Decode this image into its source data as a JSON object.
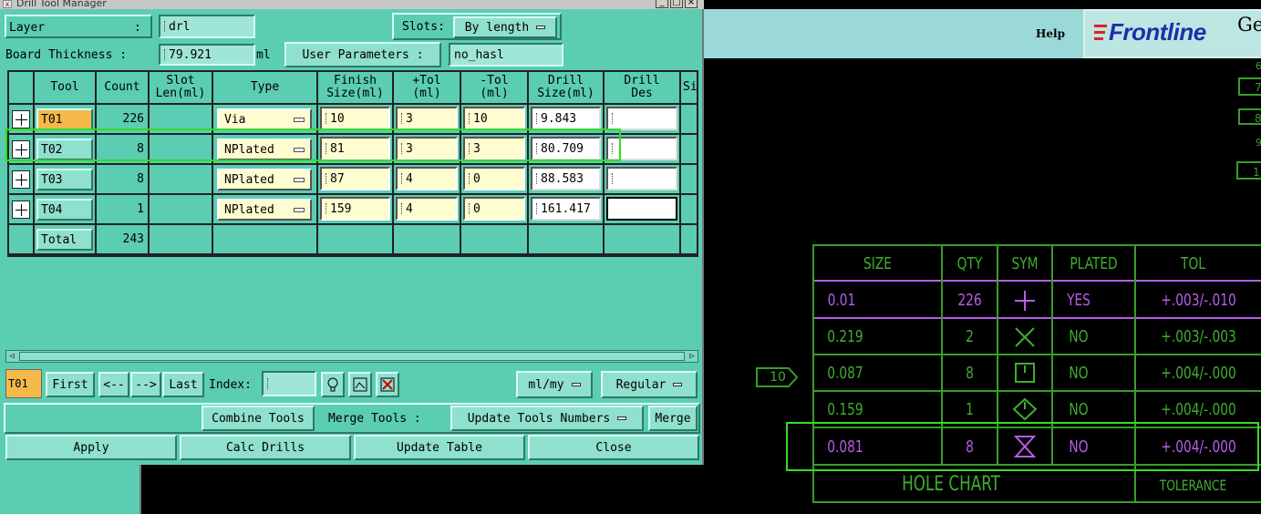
{
  "window": {
    "title": "Drill Tool Manager"
  },
  "top": {
    "layer_label": "Layer",
    "layer_colon": ":",
    "layer_value": "drl",
    "slots_label": "Slots:",
    "slots_value": "By length",
    "thickness_label": "Board Thickness :",
    "thickness_value": "79.921",
    "thickness_unit": "ml",
    "user_params_label": "User Parameters :",
    "user_params_value": "no_hasl"
  },
  "table": {
    "headers": [
      "Tool",
      "Count",
      "Slot\nLen(ml)",
      "Type",
      "Finish\nSize(ml)",
      "+Tol\n(ml)",
      "-Tol\n(ml)",
      "Drill\nSize(ml)",
      "Drill\nDes",
      "Si"
    ],
    "rows": [
      {
        "tool": "T01",
        "count": "226",
        "type": "Via",
        "finish": "10",
        "plus_tol": "3",
        "minus_tol": "10",
        "drill": "9.843",
        "des": ""
      },
      {
        "tool": "T02",
        "count": "8",
        "type": "NPlated",
        "finish": "81",
        "plus_tol": "3",
        "minus_tol": "3",
        "drill": "80.709",
        "des": ""
      },
      {
        "tool": "T03",
        "count": "8",
        "type": "NPlated",
        "finish": "87",
        "plus_tol": "4",
        "minus_tol": "0",
        "drill": "88.583",
        "des": ""
      },
      {
        "tool": "T04",
        "count": "1",
        "type": "NPlated",
        "finish": "159",
        "plus_tol": "4",
        "minus_tol": "0",
        "drill": "161.417",
        "des": ""
      }
    ],
    "total_label": "Total",
    "total_count": "243"
  },
  "nav": {
    "current_tool": "T01",
    "first": "First",
    "prev": "<--",
    "next": "-->",
    "last": "Last",
    "index_label": "Index:",
    "index_value": "",
    "units_value": "ml/my",
    "mode_value": "Regular"
  },
  "actions": {
    "combine": "Combine Tools",
    "merge_label": "Merge Tools :",
    "merge_select": "Update Tools Numbers",
    "merge_btn": "Merge",
    "apply": "Apply",
    "calc": "Calc Drills",
    "update": "Update Table",
    "close": "Close"
  },
  "app": {
    "help": "Help",
    "logo_text": "Frontline",
    "logo_partial": "Ge"
  },
  "hole_chart": {
    "headers": [
      "SIZE",
      "QTY",
      "SYM",
      "PLATED",
      "TOL"
    ],
    "rows": [
      {
        "size": "0.01",
        "qty": "226",
        "sym": "plus",
        "plated": "YES",
        "tol": "+.003/-.010",
        "color": "purple"
      },
      {
        "size": "0.219",
        "qty": "2",
        "sym": "x",
        "plated": "NO",
        "tol": "+.003/-.003",
        "color": "green"
      },
      {
        "size": "0.087",
        "qty": "8",
        "sym": "square-mark",
        "plated": "NO",
        "tol": "+.004/-.000",
        "color": "green"
      },
      {
        "size": "0.159",
        "qty": "1",
        "sym": "diamond",
        "plated": "NO",
        "tol": "+.004/-.000",
        "color": "green"
      },
      {
        "size": "0.081",
        "qty": "8",
        "sym": "hourglass",
        "plated": "NO",
        "tol": "+.004/-.000",
        "color": "purple"
      }
    ],
    "footer": "HOLE CHART",
    "footer_tol": "TOLERANCE",
    "flag_label": "10"
  },
  "colors": {
    "dialog_bg": "#5bcdb2",
    "highlight": "#33dd22",
    "chart_green": "#3fae2e",
    "chart_purple": "#b65de8",
    "logo_blue": "#1f2fa8"
  }
}
